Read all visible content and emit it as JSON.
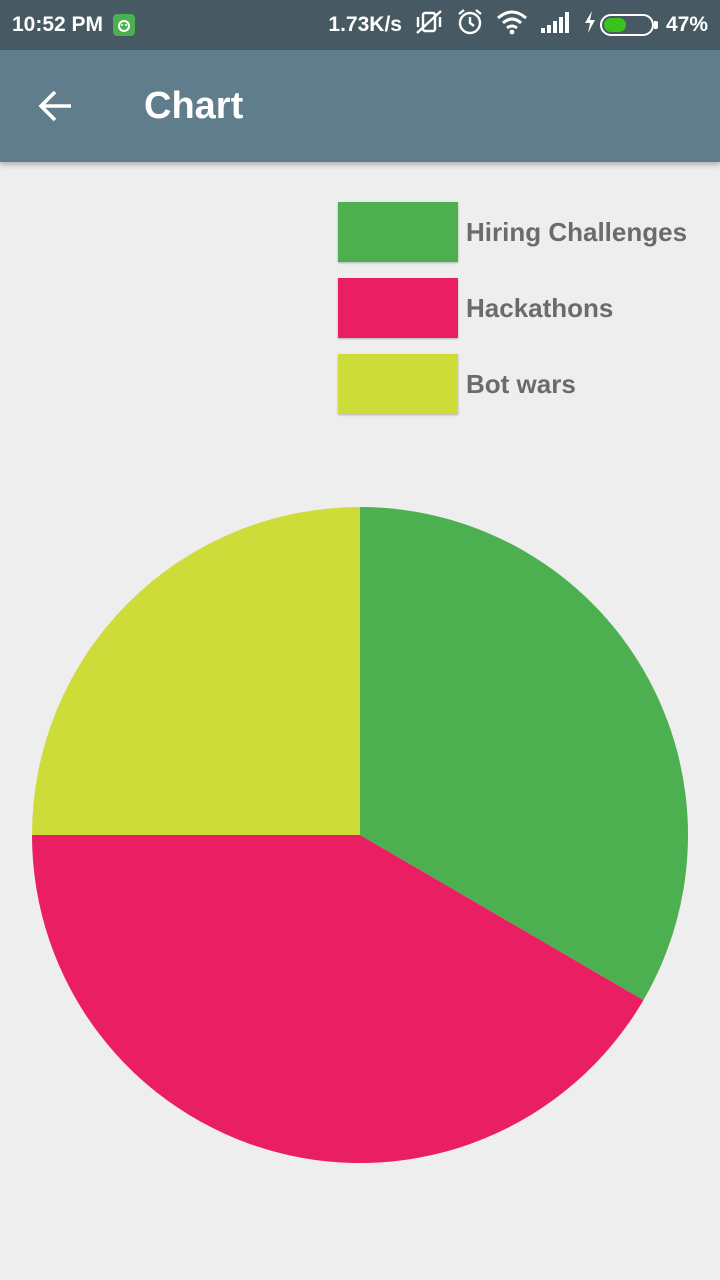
{
  "status_bar": {
    "time": "10:52 PM",
    "net_speed": "1.73K/s",
    "battery_percent": "47%",
    "battery_level": 0.47,
    "icons": [
      "app-notification-icon",
      "vibrate-off-icon",
      "alarm-icon",
      "wifi-icon",
      "signal-icon",
      "charging-icon",
      "battery-icon"
    ]
  },
  "app_bar": {
    "title": "Chart",
    "back_icon": "arrow-back-icon"
  },
  "colors": {
    "status_bar": "#475a63",
    "app_bar": "#607d8b",
    "background": "#eeeeee",
    "hiring": "#4caf50",
    "hackathons": "#e91e63",
    "bot_wars": "#cddc39"
  },
  "chart_data": {
    "type": "pie",
    "categories": [
      "Hiring Challenges",
      "Hackathons",
      "Bot wars"
    ],
    "values": [
      33.4,
      41.6,
      25
    ],
    "colors": [
      "#4caf50",
      "#e91e63",
      "#cddc39"
    ],
    "start_angle_deg": -90,
    "direction": "clockwise",
    "legend_position": "top-right"
  }
}
